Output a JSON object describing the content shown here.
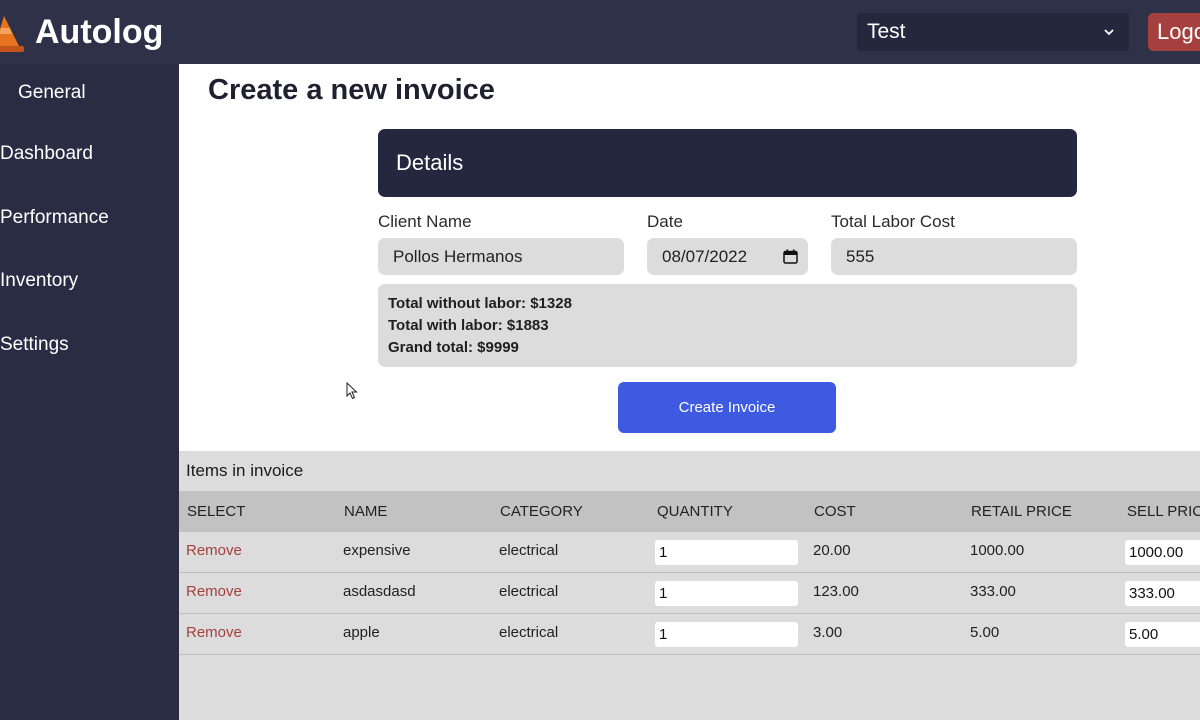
{
  "app": {
    "brand": "Autolog",
    "environment": "Test",
    "logout_label": "Logout"
  },
  "sidebar": {
    "items": [
      {
        "label": "General"
      },
      {
        "label": "Dashboard"
      },
      {
        "label": "Performance"
      },
      {
        "label": "Inventory"
      },
      {
        "label": "Settings"
      }
    ]
  },
  "page": {
    "title": "Create a new invoice"
  },
  "details": {
    "header": "Details",
    "client_name_label": "Client Name",
    "client_name_value": "Pollos Hermanos",
    "date_label": "Date",
    "date_value": "08/07/2022",
    "labor_label": "Total Labor Cost",
    "labor_value": "555",
    "totals": {
      "without_labor": "Total without labor: $1328",
      "with_labor": "Total with labor: $1883",
      "grand_total": "Grand total: $9999"
    },
    "create_button": "Create Invoice"
  },
  "items": {
    "title": "Items in invoice",
    "columns": [
      "SELECT",
      "NAME",
      "CATEGORY",
      "QUANTITY",
      "COST",
      "RETAIL PRICE",
      "SELL PRICE"
    ],
    "rows": [
      {
        "action": "Remove",
        "name": "expensive",
        "category": "electrical",
        "quantity": "1",
        "cost": "20.00",
        "retail": "1000.00",
        "sell": "1000.00"
      },
      {
        "action": "Remove",
        "name": "asdasdasd",
        "category": "electrical",
        "quantity": "1",
        "cost": "123.00",
        "retail": "333.00",
        "sell": "333.00"
      },
      {
        "action": "Remove",
        "name": "apple",
        "category": "electrical",
        "quantity": "1",
        "cost": "3.00",
        "retail": "5.00",
        "sell": "5.00"
      }
    ]
  },
  "colors": {
    "topbar": "#2f3149",
    "sidebar": "#2a2c44",
    "accent_button": "#3d5ae0",
    "danger": "#a4403e"
  }
}
